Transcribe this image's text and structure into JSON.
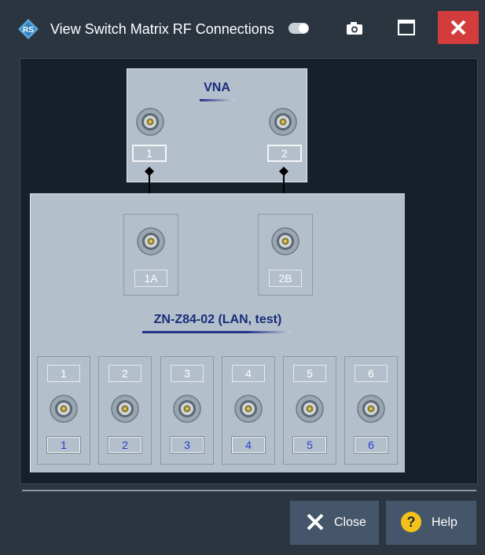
{
  "window": {
    "title": "View Switch Matrix RF Connections",
    "logo_icon": "rohde-schwarz-logo",
    "toggle_icon": "toggle-icon",
    "camera_icon": "camera-icon",
    "maximize_icon": "maximize-icon",
    "close_icon": "close-icon",
    "close_color": "#d23c3c"
  },
  "vna": {
    "title": "VNA",
    "ports": [
      "1",
      "2"
    ]
  },
  "switch_matrix": {
    "title": "ZN-Z84-02 (LAN, test)",
    "vna_ports": [
      "1A",
      "2B"
    ],
    "test_ports": [
      {
        "tag": "1",
        "number": "1"
      },
      {
        "tag": "2",
        "number": "2"
      },
      {
        "tag": "3",
        "number": "3"
      },
      {
        "tag": "4",
        "number": "4"
      },
      {
        "tag": "5",
        "number": "5"
      },
      {
        "tag": "6",
        "number": "6"
      }
    ]
  },
  "buttons": {
    "close_label": "Close",
    "help_label": "Help",
    "help_icon_color": "#f2c21b"
  },
  "colors": {
    "panel_bg": "#b3bfca",
    "canvas_bg": "#15202a",
    "title_accent": "#182c7a",
    "port_number_text": "#2a3cd8"
  }
}
